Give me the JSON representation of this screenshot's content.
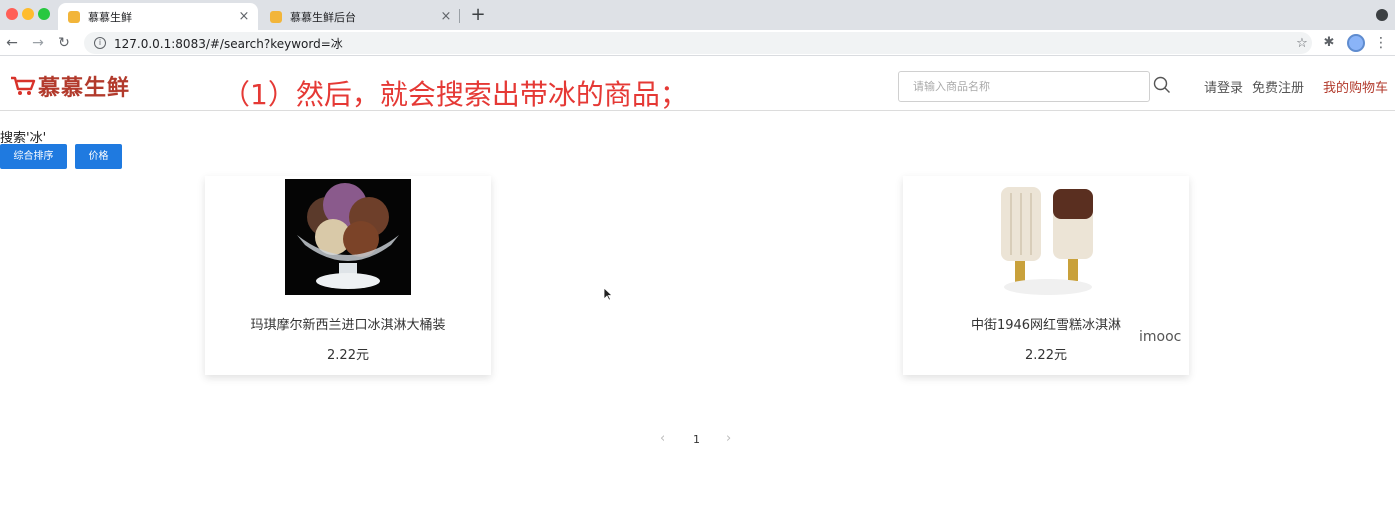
{
  "browser": {
    "tabs": [
      {
        "title": "慕慕生鲜",
        "close": "×"
      },
      {
        "title": "慕慕生鲜后台",
        "close": "×"
      }
    ],
    "new_tab": "+",
    "url": "127.0.0.1:8083/#/search?keyword=冰"
  },
  "header": {
    "logo_text": "慕慕生鲜",
    "caption": "（1）然后，就会搜索出带冰的商品；",
    "search_placeholder": "请输入商品名称",
    "login": "请登录",
    "register": "免费注册",
    "cart": "我的购物车"
  },
  "search": {
    "label": "搜索'冰'",
    "sort_default": "综合排序",
    "sort_price": "价格"
  },
  "products": [
    {
      "name": "玛琪摩尔新西兰进口冰淇淋大桶装",
      "price": "2.22元"
    },
    {
      "name": "中街1946网红雪糕冰淇淋",
      "price": "2.22元"
    }
  ],
  "watermark": "imooc",
  "pagination": {
    "prev": "‹",
    "current": "1",
    "next": "›"
  },
  "colors": {
    "accent": "#1f7ae0",
    "brand": "#b23a2c",
    "caption": "#e53935"
  }
}
